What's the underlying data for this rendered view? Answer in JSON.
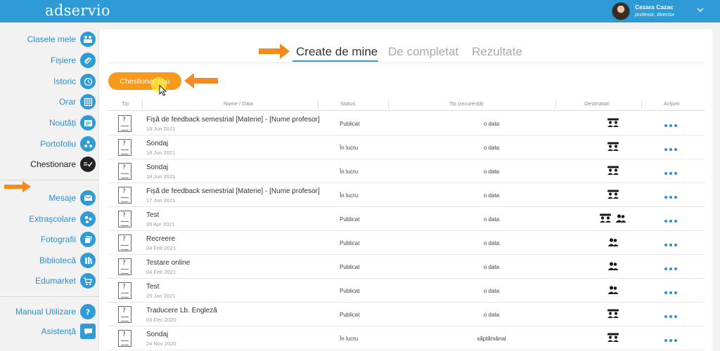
{
  "app": {
    "logo": "adservio",
    "user": {
      "name": "Cezara Cazac",
      "role": "profesor, director"
    }
  },
  "colors": {
    "brand": "#2e9bd6",
    "accent": "#f79a1b",
    "active": "#222222"
  },
  "sidebar": {
    "items": [
      {
        "label": "Clasele mele",
        "icon": "classes-icon"
      },
      {
        "label": "Fișiere",
        "icon": "paperclip-icon"
      },
      {
        "label": "Istoric",
        "icon": "history-icon"
      },
      {
        "label": "Orar",
        "icon": "calendar-icon"
      },
      {
        "label": "Noutăți",
        "icon": "news-icon"
      },
      {
        "label": "Portofoliu",
        "icon": "portfolio-icon"
      },
      {
        "label": "Chestionare",
        "icon": "checklist-icon",
        "active": true
      },
      {
        "label": "Mesaje",
        "icon": "envelope-icon"
      },
      {
        "label": "Extrașcolare",
        "icon": "activities-icon"
      },
      {
        "label": "Fotografii",
        "icon": "photos-icon"
      },
      {
        "label": "Bibliotecă",
        "icon": "library-icon"
      },
      {
        "label": "Edumarket",
        "icon": "cart-icon"
      },
      {
        "label": "Manual Utilizare",
        "icon": "help-icon"
      },
      {
        "label": "Asistență",
        "icon": "chat-icon"
      }
    ]
  },
  "tabs": [
    {
      "label": "Create de mine",
      "active": true
    },
    {
      "label": "De completat"
    },
    {
      "label": "Rezultate"
    }
  ],
  "new_button": {
    "label": "Chestionar nou"
  },
  "table": {
    "headers": [
      "Tip",
      "Nume / Data",
      "Status",
      "Tip (recurență)",
      "Destinatari",
      "Acțiuni"
    ],
    "rows": [
      {
        "name": "Fișă de feedback semestrial [Materie] - [Nume profesor]",
        "date": "18 Jun 2021",
        "status": "Publicat",
        "tip": "o data",
        "dest": [
          "group"
        ]
      },
      {
        "name": "Sondaj",
        "date": "18 Jun 2021",
        "status": "În lucru",
        "tip": "o data",
        "dest": [
          "group"
        ]
      },
      {
        "name": "Sondaj",
        "date": "18 Jun 2021",
        "status": "În lucru",
        "tip": "o data",
        "dest": [
          "group"
        ]
      },
      {
        "name": "Fișă de feedback semestrial [Materie] - [Nume profesor]",
        "date": "17 Jun 2021",
        "status": "În lucru",
        "tip": "o data",
        "dest": [
          "group"
        ]
      },
      {
        "name": "Test",
        "date": "20 Apr 2021",
        "status": "Publicat",
        "tip": "o data",
        "dest": [
          "group",
          "users"
        ]
      },
      {
        "name": "Recreere",
        "date": "04 Feb 2021",
        "status": "Publicat",
        "tip": "o data",
        "dest": [
          "users"
        ]
      },
      {
        "name": "Testare online",
        "date": "04 Feb 2021",
        "status": "Publicat",
        "tip": "o data",
        "dest": [
          "users"
        ]
      },
      {
        "name": "Test",
        "date": "25 Jan 2021",
        "status": "Publicat",
        "tip": "o data",
        "dest": [
          "users"
        ]
      },
      {
        "name": "Traducere Lb. Engleză",
        "date": "03 Dec 2020",
        "status": "Publicat",
        "tip": "o data",
        "dest": [
          "group"
        ]
      },
      {
        "name": "Sondaj",
        "date": "24 Nov 2020",
        "status": "În lucru",
        "tip": "săptămânal",
        "dest": [
          "group"
        ]
      }
    ]
  }
}
